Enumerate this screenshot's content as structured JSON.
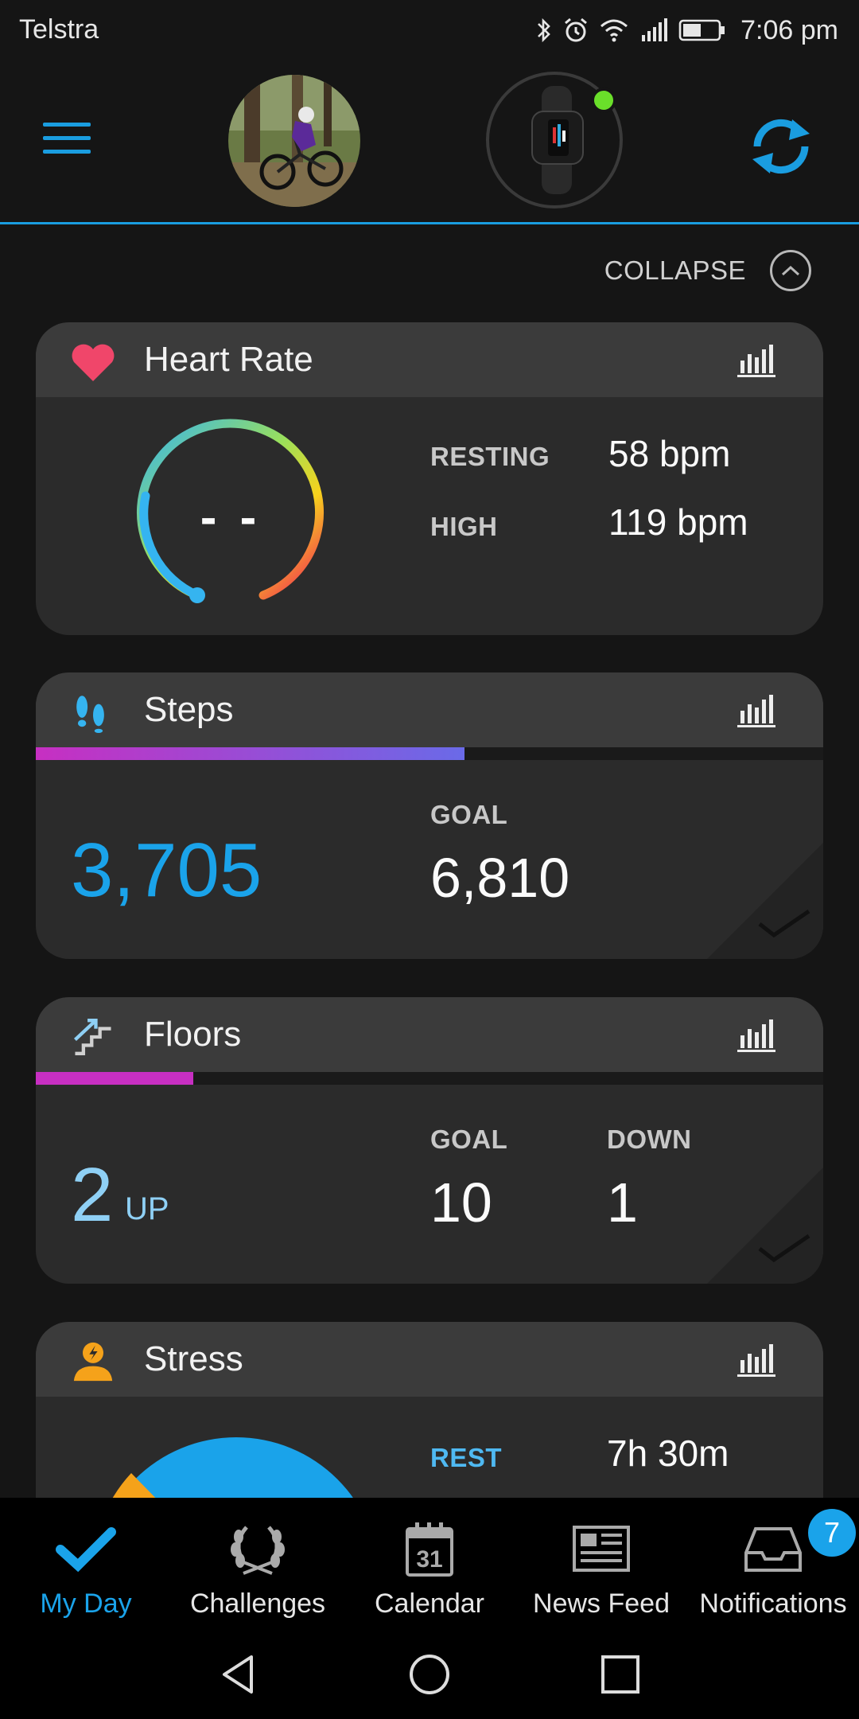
{
  "status_bar": {
    "carrier": "Telstra",
    "time": "7:06 pm",
    "icons": [
      "bluetooth-icon",
      "alarm-icon",
      "wifi-icon",
      "signal-icon",
      "battery-icon"
    ]
  },
  "header": {
    "menu_icon": "hamburger-icon",
    "profile": "profile-photo",
    "device": "fitness-band",
    "device_status_color": "#6adf2a",
    "sync_icon": "sync-icon"
  },
  "collapse": {
    "label": "COLLAPSE"
  },
  "cards": {
    "heart_rate": {
      "title": "Heart Rate",
      "current": "- -",
      "resting_label": "RESTING",
      "resting_value": "58 bpm",
      "high_label": "HIGH",
      "high_value": "119 bpm"
    },
    "steps": {
      "title": "Steps",
      "value": "3,705",
      "goal_label": "GOAL",
      "goal_value": "6,810",
      "progress": 0.544
    },
    "floors": {
      "title": "Floors",
      "value": "2",
      "unit": "UP",
      "goal_label": "GOAL",
      "goal_value": "10",
      "down_label": "DOWN",
      "down_value": "1",
      "progress": 0.2
    },
    "stress": {
      "title": "Stress",
      "rest_label": "REST",
      "rest_value": "7h 30m"
    }
  },
  "nav": {
    "items": [
      {
        "label": "My Day",
        "icon": "checkmark-icon",
        "active": true
      },
      {
        "label": "Challenges",
        "icon": "laurel-icon",
        "active": false
      },
      {
        "label": "Calendar",
        "icon": "calendar-icon",
        "date": "31",
        "active": false
      },
      {
        "label": "News Feed",
        "icon": "newspaper-icon",
        "active": false
      },
      {
        "label": "Notifications",
        "icon": "inbox-icon",
        "active": false
      }
    ],
    "notification_badge": "7"
  },
  "colors": {
    "accent": "#1aa3ea",
    "steps_value": "#1aa3ea",
    "floors_value": "#8fd0f5",
    "heart": "#f0466a"
  }
}
